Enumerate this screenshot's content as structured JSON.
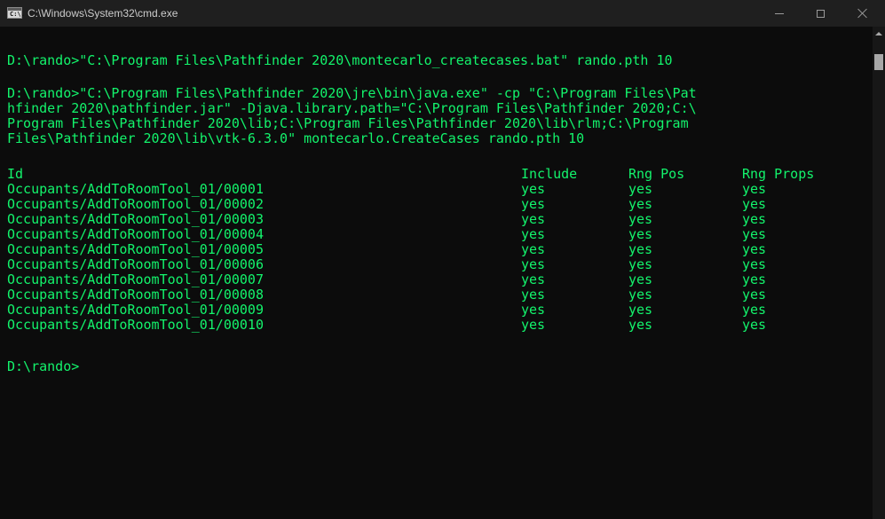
{
  "window": {
    "title": "C:\\Windows\\System32\\cmd.exe",
    "icon": "cmd-app-icon",
    "icon_text": "C:\\."
  },
  "controls": {
    "minimize_icon": "minimize-icon",
    "maximize_icon": "maximize-icon",
    "close_icon": "close-icon"
  },
  "console": {
    "command1": "D:\\rando>\"C:\\Program Files\\Pathfinder 2020\\montecarlo_createcases.bat\" rando.pth 10",
    "command2_lines": [
      "D:\\rando>\"C:\\Program Files\\Pathfinder 2020\\jre\\bin\\java.exe\" -cp \"C:\\Program Files\\Pat",
      "hfinder 2020\\pathfinder.jar\" -Djava.library.path=\"C:\\Program Files\\Pathfinder 2020;C:\\",
      "Program Files\\Pathfinder 2020\\lib;C:\\Program Files\\Pathfinder 2020\\lib\\rlm;C:\\Program",
      "Files\\Pathfinder 2020\\lib\\vtk-6.3.0\" montecarlo.CreateCases rando.pth 10"
    ],
    "table": {
      "headers": {
        "id": "Id",
        "include": "Include",
        "rng_pos": "Rng Pos",
        "rng_props": "Rng Props"
      },
      "rows": [
        {
          "id": "Occupants/AddToRoomTool_01/00001",
          "include": "yes",
          "rng_pos": "yes",
          "rng_props": "yes"
        },
        {
          "id": "Occupants/AddToRoomTool_01/00002",
          "include": "yes",
          "rng_pos": "yes",
          "rng_props": "yes"
        },
        {
          "id": "Occupants/AddToRoomTool_01/00003",
          "include": "yes",
          "rng_pos": "yes",
          "rng_props": "yes"
        },
        {
          "id": "Occupants/AddToRoomTool_01/00004",
          "include": "yes",
          "rng_pos": "yes",
          "rng_props": "yes"
        },
        {
          "id": "Occupants/AddToRoomTool_01/00005",
          "include": "yes",
          "rng_pos": "yes",
          "rng_props": "yes"
        },
        {
          "id": "Occupants/AddToRoomTool_01/00006",
          "include": "yes",
          "rng_pos": "yes",
          "rng_props": "yes"
        },
        {
          "id": "Occupants/AddToRoomTool_01/00007",
          "include": "yes",
          "rng_pos": "yes",
          "rng_props": "yes"
        },
        {
          "id": "Occupants/AddToRoomTool_01/00008",
          "include": "yes",
          "rng_pos": "yes",
          "rng_props": "yes"
        },
        {
          "id": "Occupants/AddToRoomTool_01/00009",
          "include": "yes",
          "rng_pos": "yes",
          "rng_props": "yes"
        },
        {
          "id": "Occupants/AddToRoomTool_01/00010",
          "include": "yes",
          "rng_pos": "yes",
          "rng_props": "yes"
        }
      ]
    },
    "prompt": "D:\\rando>"
  },
  "colors": {
    "console_text": "#13f46c",
    "console_background": "#0c0c0c",
    "titlebar_background": "#1f1f1f"
  },
  "scrollbar": {
    "up_icon": "scroll-up-arrow-icon"
  }
}
